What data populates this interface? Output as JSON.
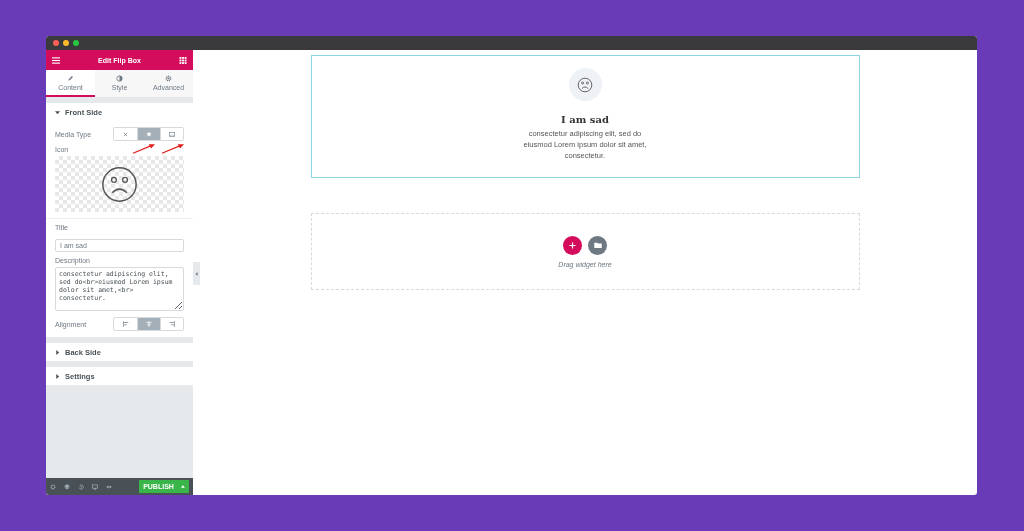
{
  "window": {
    "title": "Edit Flip Box"
  },
  "tabs": [
    {
      "label": "Content",
      "kind": "pencil",
      "selected": true
    },
    {
      "label": "Style",
      "kind": "contrast",
      "selected": false
    },
    {
      "label": "Advanced",
      "kind": "gear",
      "selected": false
    }
  ],
  "front_side": {
    "title": "Front Side",
    "expanded": true,
    "media_type": {
      "label": "Media Type",
      "options": [
        {
          "kind": "none",
          "selected": false
        },
        {
          "kind": "icon",
          "selected": true
        },
        {
          "kind": "image",
          "selected": false
        }
      ]
    },
    "icon_label": "Icon",
    "title_field": {
      "label": "Title",
      "value": "I am sad"
    },
    "description_field": {
      "label": "Description",
      "value": "consectetur adipiscing elit, sed do<br>eiusmod Lorem ipsum dolor sit amet,<br> consectetur."
    },
    "alignment": {
      "label": "Alignment",
      "options": [
        {
          "kind": "left",
          "selected": false
        },
        {
          "kind": "center",
          "selected": true
        },
        {
          "kind": "right",
          "selected": false
        }
      ]
    }
  },
  "other_sections": [
    {
      "title": "Back Side",
      "expanded": false
    },
    {
      "title": "Settings",
      "expanded": false
    }
  ],
  "footer": {
    "publish": "PUBLISH"
  },
  "flip_box": {
    "title": "I am sad",
    "description_lines": [
      "consectetur adipiscing elit, sed do",
      "eiusmod Lorem ipsum dolor sit amet,",
      "consectetur."
    ]
  },
  "drop_zone": {
    "hint": "Drag widget here"
  }
}
